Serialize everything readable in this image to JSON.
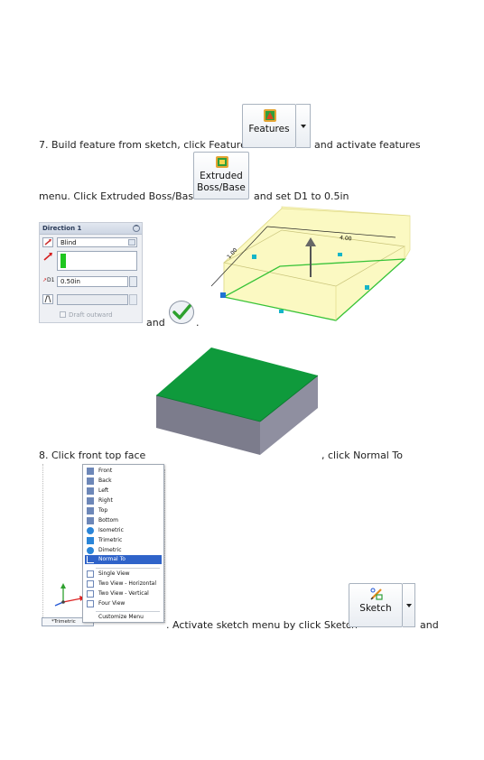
{
  "step7": {
    "text_a": "7. Build feature from sketch, click Features",
    "text_b": "and activate features",
    "text_c": "menu. Click Extruded Boss/Base",
    "text_d": "and set D1 to 0.5in",
    "features_label": "Features",
    "extrude_label_1": "Extruded",
    "extrude_label_2": "Boss/Base"
  },
  "property_manager": {
    "header": "Direction 1",
    "end_condition": "Blind",
    "depth_value": "0.50in",
    "d1_label": "D1",
    "draft_label": "Draft outward",
    "accent_green": "#1fc61f"
  },
  "model": {
    "dim_top": "4.00",
    "dim_side": "1.00",
    "face_color": "#fbf9c2",
    "edge_color": "#37c337"
  },
  "ok_connector": "and",
  "ok_period": ".",
  "step8": {
    "text_a": "8. Click front top face",
    "text_b": ", click Normal To",
    "text_c": ". Activate sketch menu by click Sketch",
    "text_d": "and",
    "sketch_label": "Sketch",
    "block_top_color": "#0f9a3c",
    "block_side_color": "#7f7f8e"
  },
  "view_menu": {
    "items": [
      "Front",
      "Back",
      "Left",
      "Right",
      "Top",
      "Bottom",
      "Isometric",
      "Trimetric",
      "Dimetric",
      "Normal To"
    ],
    "views": [
      "Single View",
      "Two View - Horizontal",
      "Two View - Vertical",
      "Four View"
    ],
    "customize": "Customize Menu",
    "current_view": "*Trimetric",
    "selected_color": "#2f63c9"
  }
}
